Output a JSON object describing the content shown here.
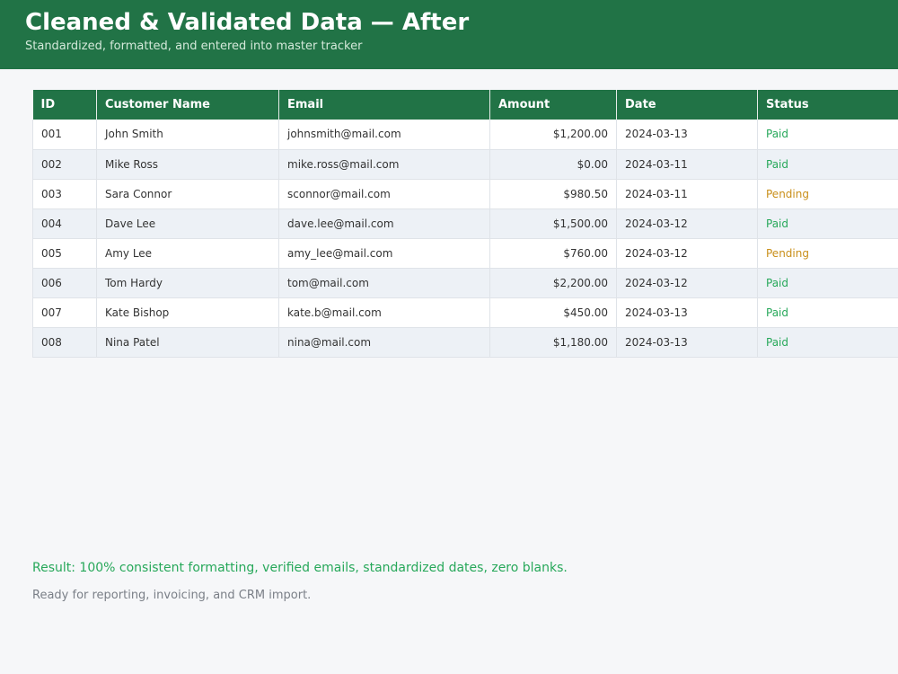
{
  "header": {
    "title": "Cleaned & Validated Data — After",
    "subtitle": "Standardized, formatted, and entered into master tracker"
  },
  "table": {
    "columns": [
      "ID",
      "Customer Name",
      "Email",
      "Amount",
      "Date",
      "Status"
    ],
    "rows": [
      {
        "id": "001",
        "name": "John Smith",
        "email": "johnsmith@mail.com",
        "amount": "$1,200.00",
        "date": "2024-03-13",
        "status": "Paid"
      },
      {
        "id": "002",
        "name": "Mike Ross",
        "email": "mike.ross@mail.com",
        "amount": "$0.00",
        "date": "2024-03-11",
        "status": "Paid"
      },
      {
        "id": "003",
        "name": "Sara Connor",
        "email": "sconnor@mail.com",
        "amount": "$980.50",
        "date": "2024-03-11",
        "status": "Pending"
      },
      {
        "id": "004",
        "name": "Dave Lee",
        "email": "dave.lee@mail.com",
        "amount": "$1,500.00",
        "date": "2024-03-12",
        "status": "Paid"
      },
      {
        "id": "005",
        "name": "Amy Lee",
        "email": "amy_lee@mail.com",
        "amount": "$760.00",
        "date": "2024-03-12",
        "status": "Pending"
      },
      {
        "id": "006",
        "name": "Tom Hardy",
        "email": "tom@mail.com",
        "amount": "$2,200.00",
        "date": "2024-03-12",
        "status": "Paid"
      },
      {
        "id": "007",
        "name": "Kate Bishop",
        "email": "kate.b@mail.com",
        "amount": "$450.00",
        "date": "2024-03-13",
        "status": "Paid"
      },
      {
        "id": "008",
        "name": "Nina Patel",
        "email": "nina@mail.com",
        "amount": "$1,180.00",
        "date": "2024-03-13",
        "status": "Paid"
      }
    ]
  },
  "footer": {
    "result": "Result: 100% consistent formatting, verified emails, standardized dates, zero blanks.",
    "note": "Ready for reporting, invoicing, and CRM import."
  },
  "colors": {
    "header_bg": "#217346",
    "paid": "#27a85a",
    "pending": "#c98f1a"
  }
}
